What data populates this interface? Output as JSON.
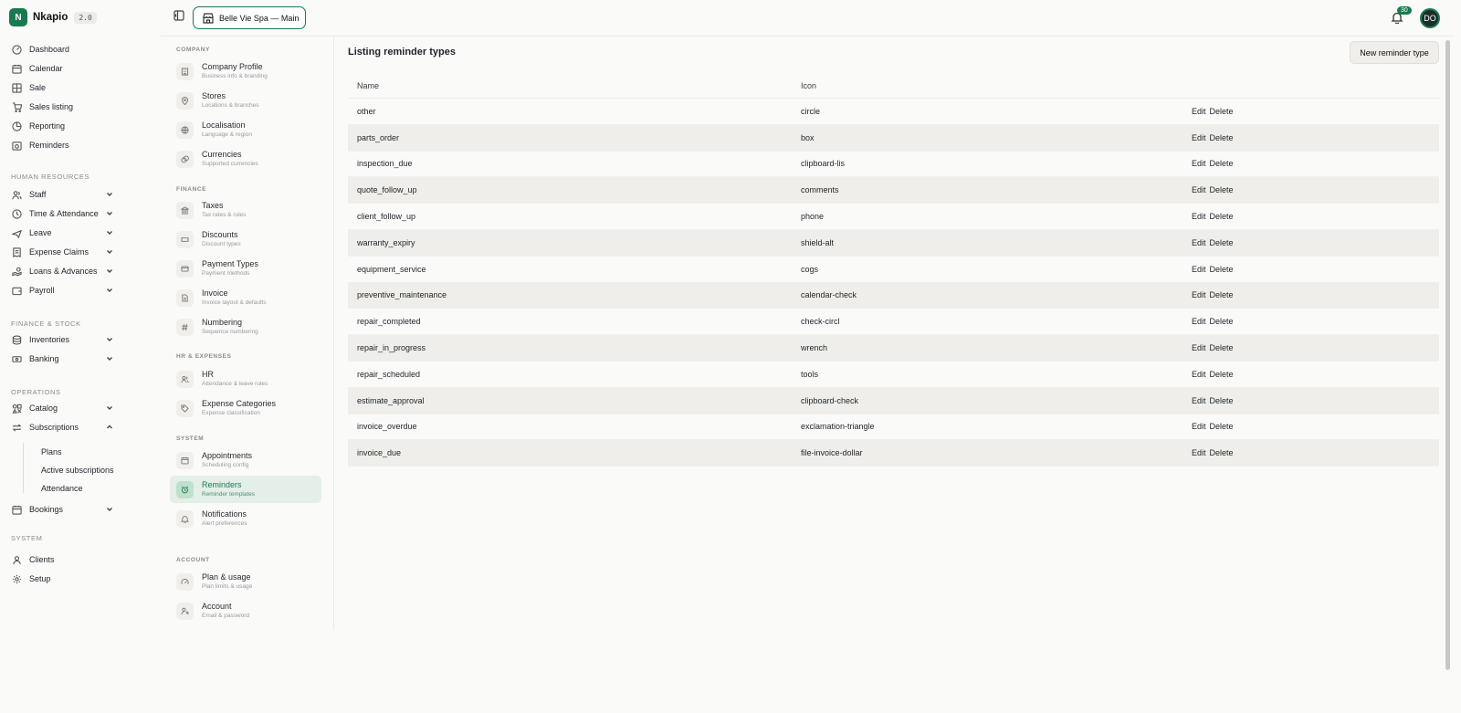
{
  "brand": {
    "initial": "N",
    "name": "Nkapio",
    "version": "2.0"
  },
  "sidebar": {
    "top_items": [
      {
        "label": "Dashboard",
        "icon": "dashboard-icon"
      },
      {
        "label": "Calendar",
        "icon": "calendar-icon"
      },
      {
        "label": "Sale",
        "icon": "grid-icon"
      },
      {
        "label": "Sales listing",
        "icon": "cart-icon"
      },
      {
        "label": "Reporting",
        "icon": "chart-icon"
      },
      {
        "label": "Reminders",
        "icon": "bell-calendar-icon"
      }
    ],
    "sections": {
      "hr": "HUMAN RESOURCES",
      "finance": "FINANCE & STOCK",
      "operations": "OPERATIONS",
      "system": "SYSTEM"
    },
    "hr_items": [
      {
        "label": "Staff"
      },
      {
        "label": "Time & Attendance"
      },
      {
        "label": "Leave"
      },
      {
        "label": "Expense Claims"
      },
      {
        "label": "Loans & Advances"
      },
      {
        "label": "Payroll"
      }
    ],
    "finance_items": [
      {
        "label": "Inventories"
      },
      {
        "label": "Banking"
      }
    ],
    "operations_items": [
      {
        "label": "Catalog"
      },
      {
        "label": "Subscriptions"
      },
      {
        "label": "Bookings"
      }
    ],
    "subscription_sub": [
      "Plans",
      "Active subscriptions",
      "Attendance"
    ],
    "system_items": [
      {
        "label": "Clients"
      },
      {
        "label": "Setup"
      }
    ]
  },
  "topbar": {
    "store_label": "Belle Vie Spa — Main",
    "notification_count": "30",
    "avatar_initials": "DO"
  },
  "settings": {
    "sections": {
      "company": "COMPANY",
      "finance": "FINANCE",
      "hr": "HR & EXPENSES",
      "system": "SYSTEM",
      "account": "ACCOUNT"
    },
    "items": [
      {
        "title": "Company Profile",
        "sub": "Business info & branding"
      },
      {
        "title": "Stores",
        "sub": "Locations & branches"
      },
      {
        "title": "Localisation",
        "sub": "Language & region"
      },
      {
        "title": "Currencies",
        "sub": "Supported currencies"
      },
      {
        "title": "Taxes",
        "sub": "Tax rates & rules"
      },
      {
        "title": "Discounts",
        "sub": "Discount types"
      },
      {
        "title": "Payment Types",
        "sub": "Payment methods"
      },
      {
        "title": "Invoice",
        "sub": "Invoice layout & defaults"
      },
      {
        "title": "Numbering",
        "sub": "Sequence numbering"
      },
      {
        "title": "HR",
        "sub": "Attendance & leave rules"
      },
      {
        "title": "Expense Categories",
        "sub": "Expense classification"
      },
      {
        "title": "Appointments",
        "sub": "Scheduling config"
      },
      {
        "title": "Reminders",
        "sub": "Reminder templates"
      },
      {
        "title": "Notifications",
        "sub": "Alert preferences"
      },
      {
        "title": "Plan & usage",
        "sub": "Plan limits & usage"
      },
      {
        "title": "Account",
        "sub": "Email & password"
      }
    ]
  },
  "main": {
    "title": "Listing reminder types",
    "new_button": "New reminder type",
    "columns": [
      "Name",
      "Icon"
    ],
    "edit_label": "Edit",
    "delete_label": "Delete",
    "rows": [
      {
        "name": "other",
        "icon": "circle"
      },
      {
        "name": "parts_order",
        "icon": "box"
      },
      {
        "name": "inspection_due",
        "icon": "clipboard-lis"
      },
      {
        "name": "quote_follow_up",
        "icon": "comments"
      },
      {
        "name": "client_follow_up",
        "icon": "phone"
      },
      {
        "name": "warranty_expiry",
        "icon": "shield-alt"
      },
      {
        "name": "equipment_service",
        "icon": "cogs"
      },
      {
        "name": "preventive_maintenance",
        "icon": "calendar-check"
      },
      {
        "name": "repair_completed",
        "icon": "check-circl"
      },
      {
        "name": "repair_in_progress",
        "icon": "wrench"
      },
      {
        "name": "repair_scheduled",
        "icon": "tools"
      },
      {
        "name": "estimate_approval",
        "icon": "clipboard-check"
      },
      {
        "name": "invoice_overdue",
        "icon": "exclamation-triangle"
      },
      {
        "name": "invoice_due",
        "icon": "file-invoice-dollar"
      }
    ]
  },
  "colors": {
    "accent": "#1a7a4f",
    "row_alt": "#efeeea",
    "background": "#fafaf8"
  }
}
